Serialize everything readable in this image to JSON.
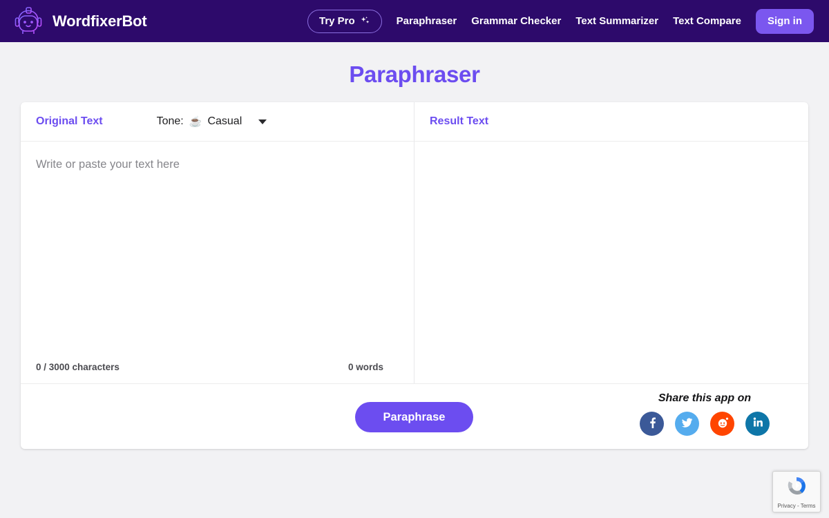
{
  "header": {
    "brand": {
      "name": "WordfixerBot",
      "logo_icon": "robot-head-icon"
    },
    "try_pro": {
      "label": "Try Pro",
      "icon": "sparkles-icon"
    },
    "nav_links": [
      {
        "label": "Paraphraser"
      },
      {
        "label": "Grammar Checker"
      },
      {
        "label": "Text Summarizer"
      },
      {
        "label": "Text Compare"
      }
    ],
    "signin_label": "Sign in",
    "colors": {
      "background": "#2d0a6b",
      "signin": "#7b57ef",
      "try_pro_border": "#8c6fe0"
    }
  },
  "page": {
    "title": "Paraphraser",
    "title_color": "#6c4df0",
    "background": "#f2f2f4"
  },
  "editor": {
    "left_panel": {
      "title": "Original Text",
      "tone": {
        "label": "Tone:",
        "emoji": "☕",
        "emoji_name": "coffee-cup-icon",
        "value": "Casual",
        "caret_icon": "chevron-down-icon"
      },
      "placeholder": "Write or paste your text here",
      "char_counter": "0 / 3000 characters",
      "word_counter": "0 words"
    },
    "right_panel": {
      "title": "Result Text"
    }
  },
  "footer": {
    "paraphrase_label": "Paraphrase",
    "paraphrase_color": "#6c4df0",
    "share_title": "Share this app on",
    "social": [
      {
        "name": "facebook",
        "icon": "facebook-icon",
        "color": "#3b5998"
      },
      {
        "name": "twitter",
        "icon": "twitter-icon",
        "color": "#55acee"
      },
      {
        "name": "reddit",
        "icon": "reddit-icon",
        "color": "#ff4500"
      },
      {
        "name": "linkedin",
        "icon": "linkedin-icon",
        "color": "#0e76a8"
      }
    ]
  },
  "recaptcha": {
    "privacy_label": "Privacy",
    "separator": "-",
    "terms_label": "Terms",
    "icon": "recaptcha-icon"
  }
}
